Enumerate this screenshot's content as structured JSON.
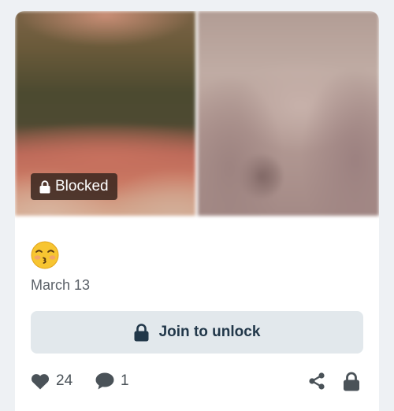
{
  "post": {
    "badge_label": "Blocked",
    "caption_emoji": "😚",
    "date": "March 13",
    "join_label": "Join to unlock",
    "likes": "24",
    "comments": "1"
  },
  "icons": {
    "badge": "lock-icon",
    "join": "lock-icon",
    "like": "heart-icon",
    "comment": "speech-bubble-icon",
    "share": "share-icon",
    "lock": "lock-icon"
  },
  "colors": {
    "page_bg": "#eef1f4",
    "card_bg": "#ffffff",
    "button_bg": "#e2e8ec",
    "button_text": "#22384a",
    "icon_gray": "#4a5258",
    "badge_bg": "#3c2820"
  }
}
